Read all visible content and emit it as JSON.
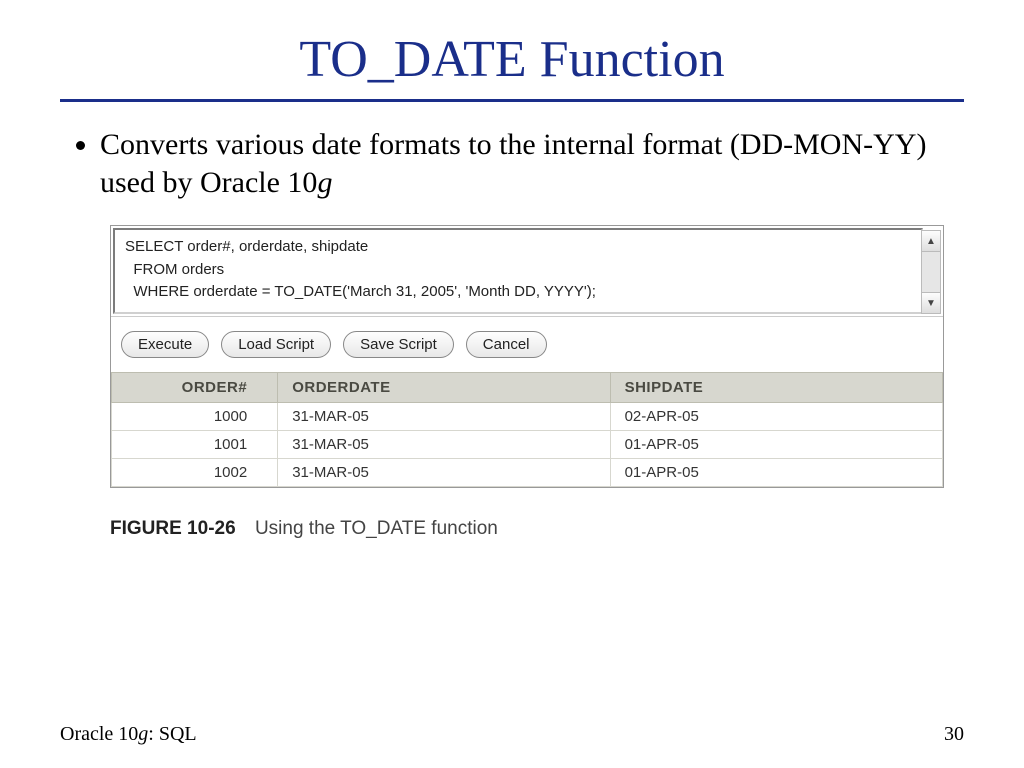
{
  "title": "TO_DATE Function",
  "bullet_prefix": "Converts various date formats to the internal format (DD-MON-YY) used by Oracle 10",
  "bullet_italic_suffix": "g",
  "sql": "SELECT order#, orderdate, shipdate\n  FROM orders\n  WHERE orderdate = TO_DATE('March 31, 2005', 'Month DD, YYYY');",
  "buttons": {
    "execute": "Execute",
    "load": "Load Script",
    "save": "Save Script",
    "cancel": "Cancel"
  },
  "table": {
    "headers": {
      "order": "ORDER#",
      "orderdate": "ORDERDATE",
      "shipdate": "SHIPDATE"
    },
    "rows": [
      {
        "order": "1000",
        "orderdate": "31-MAR-05",
        "shipdate": "02-APR-05"
      },
      {
        "order": "1001",
        "orderdate": "31-MAR-05",
        "shipdate": "01-APR-05"
      },
      {
        "order": "1002",
        "orderdate": "31-MAR-05",
        "shipdate": "01-APR-05"
      }
    ]
  },
  "figure": {
    "label": "FIGURE 10-26",
    "caption": "Using the TO_DATE function"
  },
  "footer": {
    "book_prefix": "Oracle 10",
    "book_italic": "g",
    "book_suffix": ": SQL",
    "page": "30"
  }
}
